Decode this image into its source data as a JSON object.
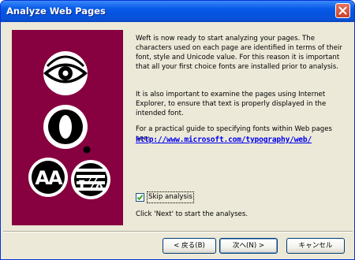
{
  "window": {
    "title": "Analyze Web Pages",
    "colors": {
      "titlebar": "#0a5ce8",
      "panel": "#87003f",
      "link": "#0000ee"
    }
  },
  "titlebar": {
    "close_icon": "close-icon"
  },
  "art": {
    "marks": [
      "AA",
      "ɪ⅞"
    ]
  },
  "content": {
    "para1": "Weft is now ready to start analyzing your pages. The characters used on each page are identified in terms of their font, style and Unicode value. For this reason it is important that all your first choice fonts are installed prior to analysis.",
    "para2": "It is also important to examine the pages using Internet Explorer, to ensure that text is properly displayed in the intended font.",
    "para3": "For a practical guide to specifying fonts within Web pages see:",
    "link": "http://www.microsoft.com/typography/web/",
    "checkbox": {
      "label": "Skip analysis",
      "checked": true
    },
    "para4": "Click 'Next' to start the analyses."
  },
  "buttons": {
    "back": "< 戻る(B)",
    "next": "次へ(N) >",
    "cancel": "キャンセル"
  }
}
